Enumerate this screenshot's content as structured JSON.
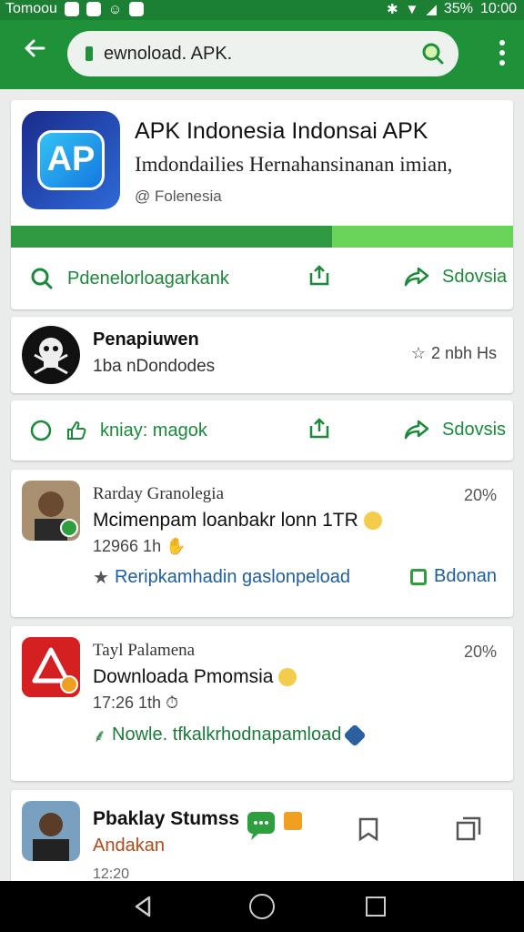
{
  "status_bar": {
    "carrier": "Tomoou",
    "battery": "35%",
    "time": "10:00"
  },
  "browser": {
    "url": "ewnoload. APK."
  },
  "hero": {
    "title": "APK Indonesia Indonsai APK",
    "subtitle": "Imdondailies Hernahansinanan imian,",
    "meta": "@ Folenesia",
    "progress": 0.64,
    "action_download": "Pdenelorloagarkank",
    "action_share": "Sdovsia"
  },
  "row2": {
    "name": "Penapiuwen",
    "sub": "1ba nDondodes",
    "meta": "2 nbh Hs"
  },
  "actions3": {
    "like": "kniay: magok",
    "share": "Sdovsis"
  },
  "post1": {
    "author": "Rarday Granolegia",
    "percent": "20%",
    "text": "Mcimenpam loanbakr lonn 1TR",
    "time": "12966 1h",
    "footer": "Reripkamhadin gaslonpeload",
    "footer_right": "Bdonan"
  },
  "post2": {
    "author": "Tayl Palamena",
    "percent": "20%",
    "text": "Downloada Pmomsia",
    "time": "17:26 1th",
    "footer": "Nowle. tfkalkrhodnapamload"
  },
  "post3": {
    "name": "Pbaklay Stumss",
    "sub": "Andakan",
    "time": "12:20"
  },
  "colors": {
    "brand": "#1f9139",
    "accent_green": "#1a8a3a",
    "link_blue": "#1d5fa0"
  }
}
